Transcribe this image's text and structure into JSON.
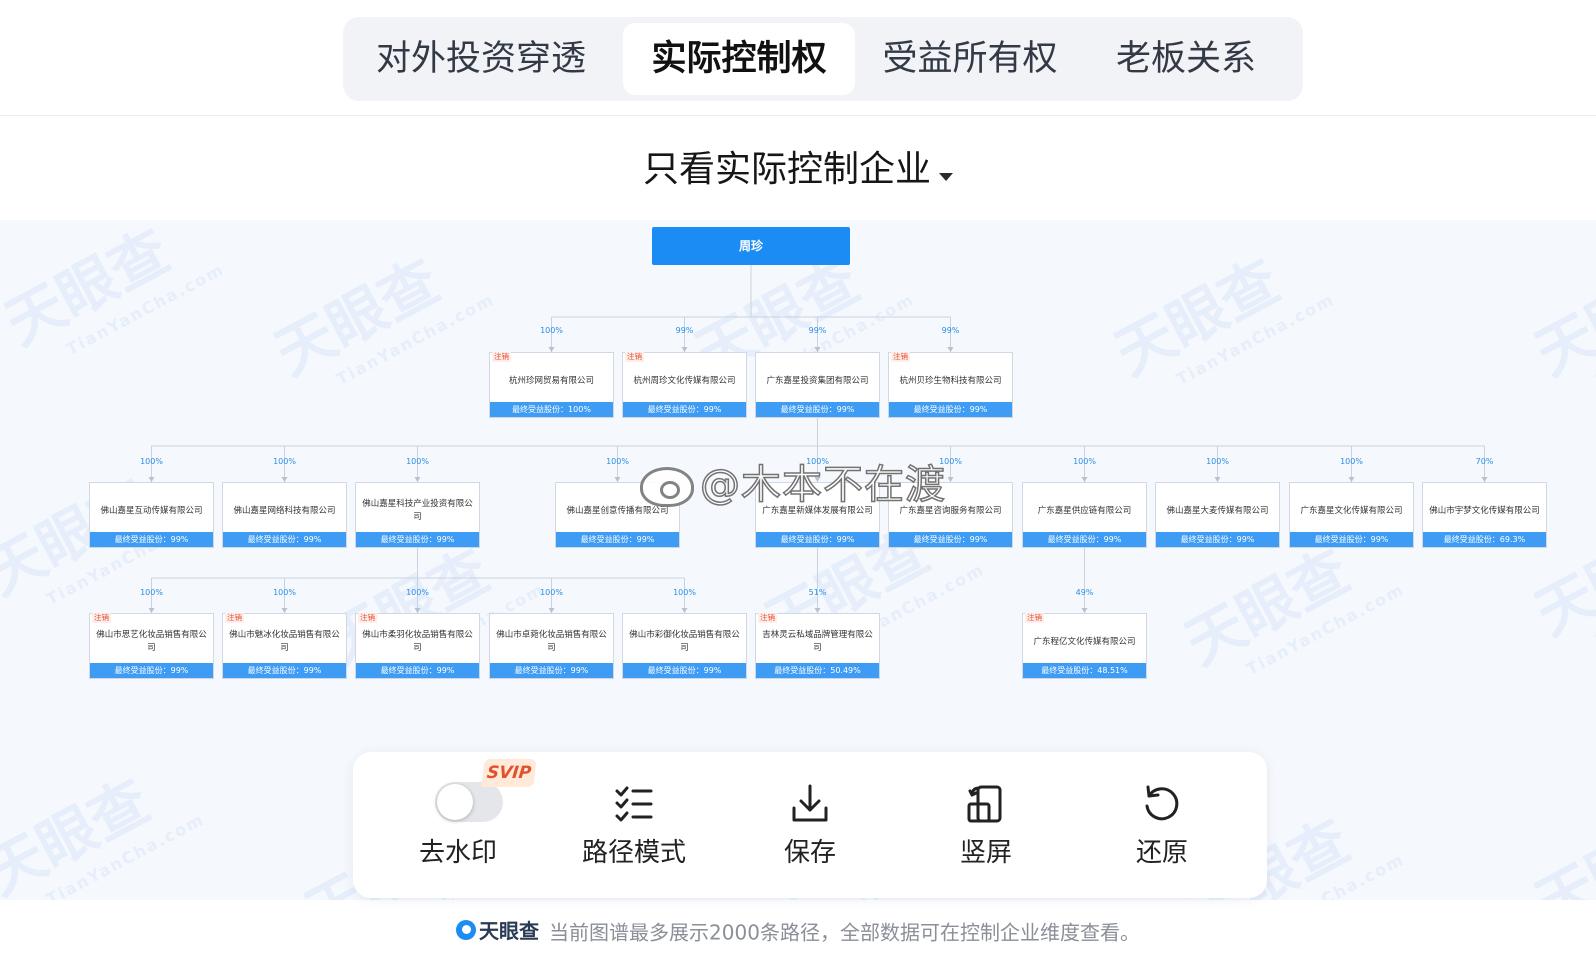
{
  "tabs": [
    {
      "label": "对外投资穿透",
      "active": false
    },
    {
      "label": "实际控制权",
      "active": true
    },
    {
      "label": "受益所有权",
      "active": false
    },
    {
      "label": "老板关系",
      "active": false
    }
  ],
  "filter": {
    "label": "只看实际控制企业"
  },
  "graph": {
    "root": {
      "name": "周珍"
    },
    "level1": [
      {
        "name": "杭州珍网贸易有限公司",
        "pct": "100%",
        "share": "最终受益股份：100%",
        "tag": "注销"
      },
      {
        "name": "杭州周珍文化传媒有限公司",
        "pct": "99%",
        "share": "最终受益股份：99%",
        "tag": "注销"
      },
      {
        "name": "广东嘉星投资集团有限公司",
        "pct": "99%",
        "share": "最终受益股份：99%",
        "tag": ""
      },
      {
        "name": "杭州贝珍生物科技有限公司",
        "pct": "99%",
        "share": "最终受益股份：99%",
        "tag": "注销"
      }
    ],
    "level2": [
      {
        "name": "佛山嘉星互动传媒有限公司",
        "pct": "100%",
        "share": "最终受益股份：99%"
      },
      {
        "name": "佛山嘉星网络科技有限公司",
        "pct": "100%",
        "share": "最终受益股份：99%"
      },
      {
        "name": "佛山嘉星科技产业投资有限公司",
        "pct": "100%",
        "share": "最终受益股份：99%"
      },
      {
        "name": "佛山嘉星创意传播有限公司",
        "pct": "100%",
        "share": "最终受益股份：99%"
      },
      {
        "name": "广东嘉星新媒体发展有限公司",
        "pct": "100%",
        "share": "最终受益股份：99%"
      },
      {
        "name": "广东嘉星咨询服务有限公司",
        "pct": "100%",
        "share": "最终受益股份：99%"
      },
      {
        "name": "广东嘉星供应链有限公司",
        "pct": "100%",
        "share": "最终受益股份：99%"
      },
      {
        "name": "佛山嘉星大麦传媒有限公司",
        "pct": "100%",
        "share": "最终受益股份：99%"
      },
      {
        "name": "广东嘉星文化传媒有限公司",
        "pct": "100%",
        "share": "最终受益股份：99%"
      },
      {
        "name": "佛山市宇梦文化传媒有限公司",
        "pct": "70%",
        "share": "最终受益股份：69.3%"
      }
    ],
    "level3": [
      {
        "name": "佛山市思艺化妆品销售有限公司",
        "pct": "100%",
        "share": "最终受益股份：99%",
        "tag": "注销"
      },
      {
        "name": "佛山市魅冰化妆品销售有限公司",
        "pct": "100%",
        "share": "最终受益股份：99%",
        "tag": "注销"
      },
      {
        "name": "佛山市柔羽化妆品销售有限公司",
        "pct": "100%",
        "share": "最终受益股份：99%",
        "tag": "注销"
      },
      {
        "name": "佛山市卓菀化妆品销售有限公司",
        "pct": "100%",
        "share": "最终受益股份：99%",
        "tag": ""
      },
      {
        "name": "佛山市彩御化妆品销售有限公司",
        "pct": "100%",
        "share": "最终受益股份：99%",
        "tag": ""
      },
      {
        "name": "吉林灵云私域品牌管理有限公司",
        "pct": "51%",
        "share": "最终受益股份：50.49%",
        "tag": "注销"
      },
      {
        "name": "广东程亿文化传媒有限公司",
        "pct": "49%",
        "share": "最终受益股份：48.51%",
        "tag": "注销"
      }
    ],
    "watermark": {
      "text": "天眼查",
      "sub": "TianYanCha.com"
    },
    "weibo_watermark": "@木本不在渡"
  },
  "toolbar": {
    "svip_badge": "SVIP",
    "items": [
      {
        "label": "去水印",
        "icon": "toggle-switch"
      },
      {
        "label": "路径模式",
        "icon": "checklist-icon"
      },
      {
        "label": "保存",
        "icon": "download-icon"
      },
      {
        "label": "竖屏",
        "icon": "rotate-screen-icon"
      },
      {
        "label": "还原",
        "icon": "reset-icon"
      }
    ]
  },
  "footer": {
    "logo": "天眼查",
    "text": "当前图谱最多展示2000条路径，全部数据可在控制企业维度查看。"
  },
  "colors": {
    "accent": "#1b8cf3",
    "share_bar": "#3e9cf4",
    "tag_red": "#e84a2e"
  }
}
